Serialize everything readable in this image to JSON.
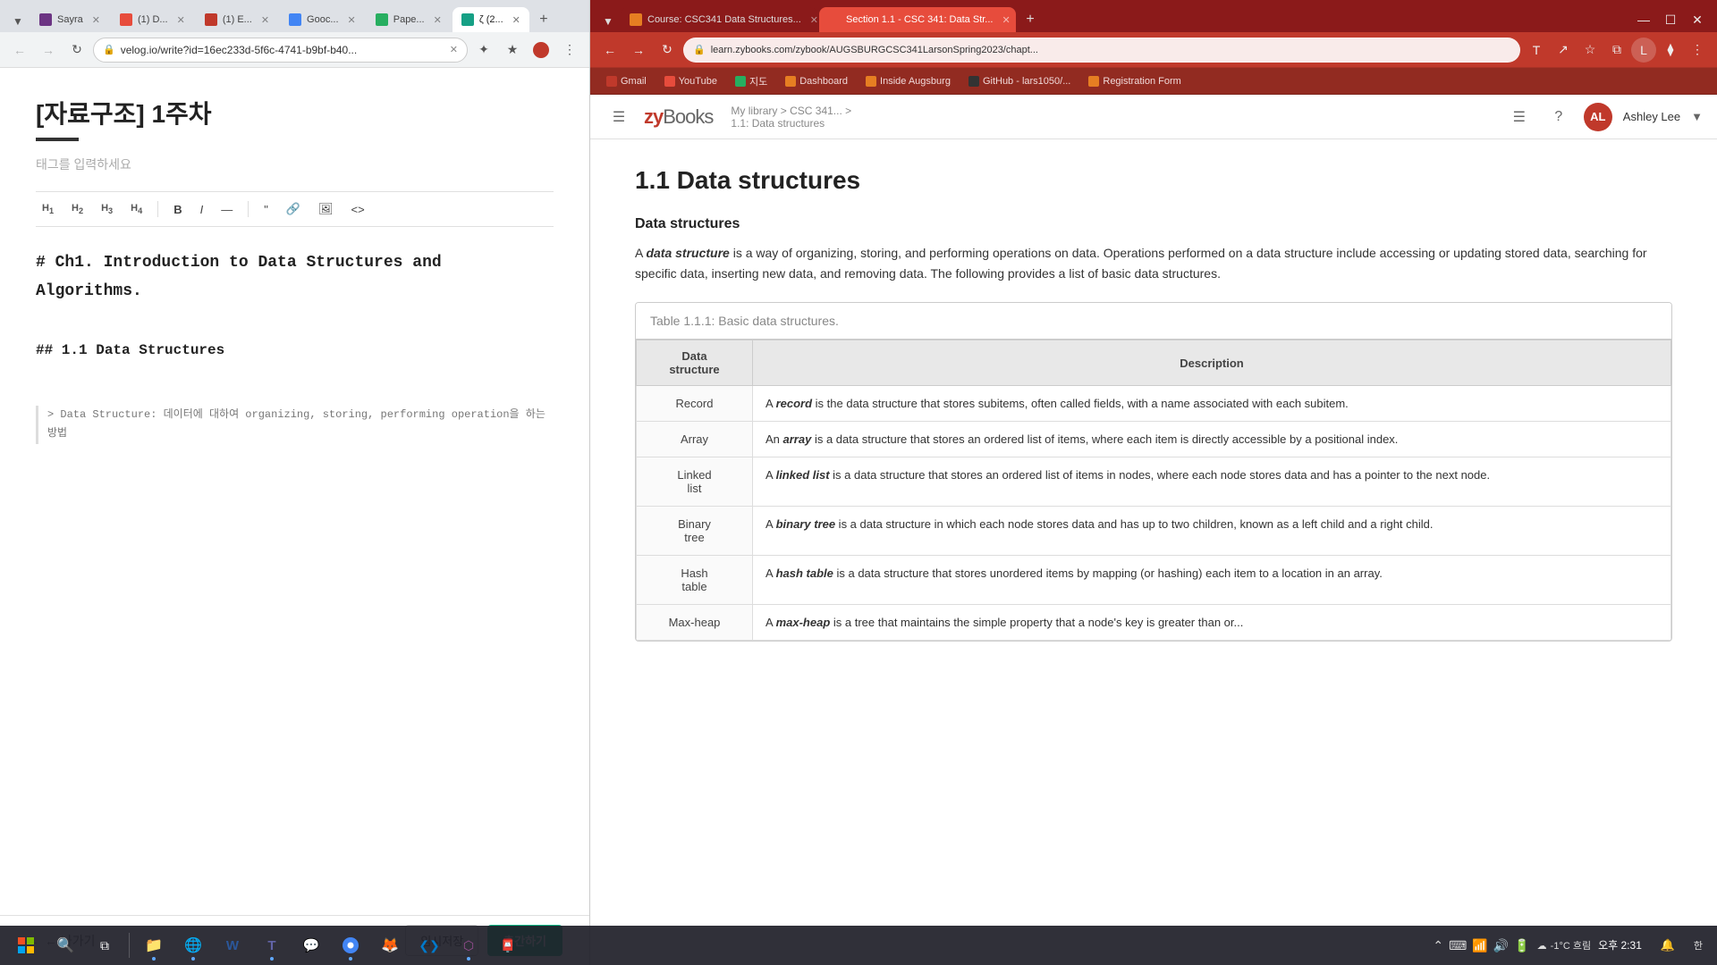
{
  "left_browser": {
    "tabs": [
      {
        "label": "Sayra",
        "favicon_color": "#6c3483",
        "active": false
      },
      {
        "label": "(1) D...",
        "favicon_color": "#e74c3c",
        "active": false
      },
      {
        "label": "(1) E...",
        "favicon_color": "#c0392b",
        "active": false
      },
      {
        "label": "Gooc...",
        "favicon_color": "#4285f4",
        "active": false
      },
      {
        "label": "Pape...",
        "favicon_color": "#27ae60",
        "active": false
      },
      {
        "label": "ζ (2...",
        "favicon_color": "#16a085",
        "active": true
      }
    ],
    "address": "velog.io/write?id=16ec233d-5f6c-4741-b9bf-b40...",
    "bookmarks": []
  },
  "editor": {
    "title": "[자료구조] 1주차",
    "tag_placeholder": "태그를 입력하세요",
    "toolbar_buttons": [
      "H₁",
      "H₂",
      "H₃",
      "H₄",
      "B",
      "I",
      "—",
      "\"",
      "🔗",
      "🖼",
      "<>"
    ],
    "body_lines": [
      "# Ch1. Introduction to Data Structures and Algorithms.",
      "",
      "## 1.1 Data Structures",
      "",
      "> Data Structure: 데이터에 대하여 organizing, storing, performing operation을 하는 방법"
    ],
    "footer": {
      "back_label": "← 나가기",
      "save_label": "임시저장",
      "publish_label": "출간하기"
    }
  },
  "right_browser": {
    "tabs": [
      {
        "label": "Course: CSC341 Data Structures...",
        "active": false
      },
      {
        "label": "Section 1.1 - CSC 341: Data Str...",
        "active": true
      }
    ],
    "address": "learn.zybooks.com/zybook/AUGSBURGCSC341LarsonSpring2023/chapt...",
    "bookmarks": [
      {
        "label": "Gmail",
        "icon": "M"
      },
      {
        "label": "YouTube",
        "icon": "▶"
      },
      {
        "label": "지도",
        "icon": "📍"
      },
      {
        "label": "Dashboard",
        "icon": "A"
      },
      {
        "label": "Inside Augsburg",
        "icon": "A"
      },
      {
        "label": "GitHub - lars1050/...",
        "icon": "⬡"
      },
      {
        "label": "Registration Form",
        "icon": "A"
      }
    ]
  },
  "zybooks": {
    "logo": "zy",
    "logo_suffix": "Books",
    "nav_breadcrumb": "My library > CSC 341... >",
    "nav_sub": "1.1: Data structures",
    "chapter_title": "1.1 Data structures",
    "user_name": "Ashley Lee",
    "user_initials": "AL",
    "section": {
      "header": "Data structures",
      "paragraph1": "A data structure is a way of organizing, storing, and performing operations on data. Operations performed on a data structure include accessing or updating stored data, searching for specific data, inserting new data, and removing data. The following provides a list of basic data structures.",
      "paragraph1_bold": "data structure",
      "table_title": "Table 1.1.1: Basic data structures.",
      "table_headers": [
        "Data structure",
        "Description"
      ],
      "table_rows": [
        {
          "name": "Record",
          "description": "A record is the data structure that stores subitems, often called fields, with a name associated with each subitem.",
          "bold": "record"
        },
        {
          "name": "Array",
          "description": "An array is a data structure that stores an ordered list of items, where each item is directly accessible by a positional index.",
          "bold": "array"
        },
        {
          "name": "Linked list",
          "description": "A linked list is a data structure that stores an ordered list of items in nodes, where each node stores data and has a pointer to the next node.",
          "bold": "linked list"
        },
        {
          "name": "Binary tree",
          "description": "A binary tree is a data structure in which each node stores data and has up to two children, known as a left child and a right child.",
          "bold": "binary tree"
        },
        {
          "name": "Hash table",
          "description": "A hash table is a data structure that stores unordered items by mapping (or hashing) each item to a location in an array.",
          "bold": "hash table"
        },
        {
          "name": "Max-heap",
          "description": "A max-heap is a tree that maintains the simple property that a node's key is greater than or...",
          "bold": "max-heap"
        }
      ]
    }
  },
  "taskbar": {
    "weather": "-1°C 흐림",
    "time": "오후 2:31",
    "system_icons": [
      "🔔",
      "⌨",
      "🔊",
      "📶"
    ],
    "apps": [
      {
        "name": "start",
        "icon": "⊞"
      },
      {
        "name": "search",
        "icon": "🔍"
      },
      {
        "name": "task-view",
        "icon": "⧉"
      },
      {
        "name": "file-explorer",
        "icon": "📁"
      },
      {
        "name": "edge",
        "icon": "🌐"
      },
      {
        "name": "word",
        "icon": "W"
      },
      {
        "name": "teams",
        "icon": "T"
      },
      {
        "name": "discord",
        "icon": "💬"
      },
      {
        "name": "chrome",
        "icon": "●"
      },
      {
        "name": "firefox",
        "icon": "🦊"
      },
      {
        "name": "vscode",
        "icon": "❮❯"
      },
      {
        "name": "postman",
        "icon": "📮"
      }
    ]
  }
}
